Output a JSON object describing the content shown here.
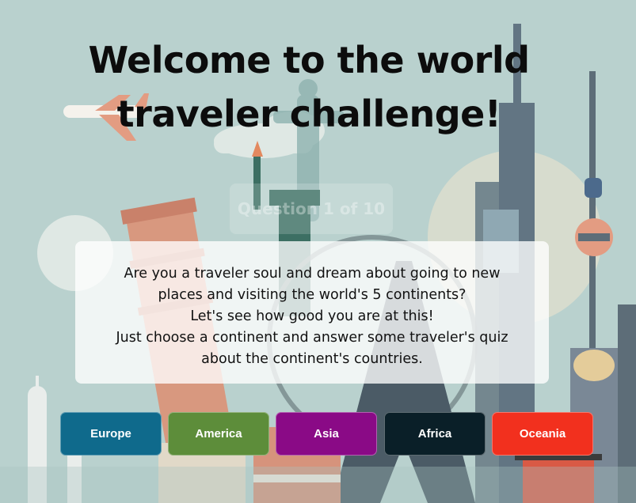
{
  "header": {
    "title_line1": "Welcome to the world",
    "title_line2": "traveler challenge!"
  },
  "background": {
    "faded_badge_text": "Question 1 of 10"
  },
  "intro": {
    "line1": "Are you a traveler soul and dream about going to new",
    "line2": "places and visiting the world's 5 continents?",
    "line3": "Let's see how good you are at this!",
    "line4": "Just choose a continent and answer some traveler's quiz",
    "line5": "about the continent's countries."
  },
  "continents": [
    {
      "label": "Europe",
      "color": "#0f6a8c"
    },
    {
      "label": "America",
      "color": "#5d8d3a"
    },
    {
      "label": "Asia",
      "color": "#8a0a86"
    },
    {
      "label": "Africa",
      "color": "#0a1f28"
    },
    {
      "label": "Oceania",
      "color": "#f2301e"
    }
  ]
}
